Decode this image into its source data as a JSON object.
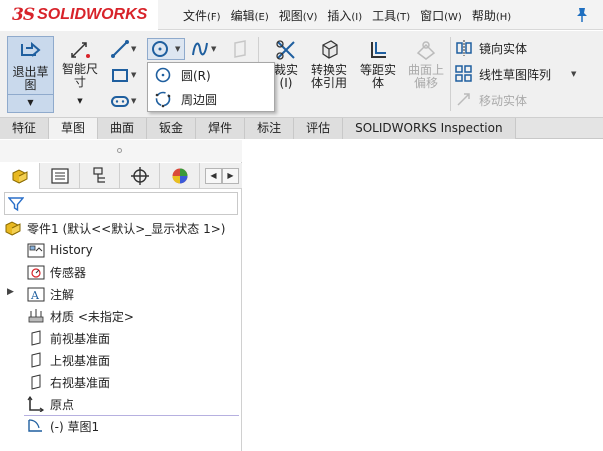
{
  "app": {
    "logo_prefix": "3S",
    "logo_text": "SOLIDWORKS"
  },
  "menu": [
    {
      "label": "文件",
      "accel": "(F)"
    },
    {
      "label": "编辑",
      "accel": "(E)"
    },
    {
      "label": "视图",
      "accel": "(V)"
    },
    {
      "label": "插入",
      "accel": "(I)"
    },
    {
      "label": "工具",
      "accel": "(T)"
    },
    {
      "label": "窗口",
      "accel": "(W)"
    },
    {
      "label": "帮助",
      "accel": "(H)"
    }
  ],
  "ribbon": {
    "exit_sketch": "退出草图",
    "smart_dimension": "智能尺寸",
    "trim_partial": "裁实",
    "trim_partial_2": "(I)",
    "convert_entities": "转换实体引用",
    "offset_entities": "等距实体",
    "offset_surface": "曲面上偏移",
    "mirror_entities": "镜向实体",
    "linear_pattern": "线性草图阵列",
    "move_entities": "移动实体"
  },
  "popup": {
    "items": [
      {
        "label": "圆(R)"
      },
      {
        "label": "周边圆"
      }
    ]
  },
  "tabs": [
    {
      "label": "特征",
      "active": false
    },
    {
      "label": "草图",
      "active": true
    },
    {
      "label": "曲面",
      "active": false
    },
    {
      "label": "钣金",
      "active": false
    },
    {
      "label": "焊件",
      "active": false
    },
    {
      "label": "标注",
      "active": false
    },
    {
      "label": "评估",
      "active": false
    },
    {
      "label": "SOLIDWORKS Inspection",
      "active": false
    }
  ],
  "tree": {
    "part": "零件1 (默认<<默认>_显示状态 1>)",
    "items": [
      {
        "label": "History"
      },
      {
        "label": "传感器"
      },
      {
        "label": "注解"
      },
      {
        "label": "材质 <未指定>"
      },
      {
        "label": "前视基准面"
      },
      {
        "label": "上视基准面"
      },
      {
        "label": "右视基准面"
      },
      {
        "label": "原点"
      },
      {
        "label": "(-) 草图1"
      }
    ]
  },
  "colors": {
    "brand": "#d8232a",
    "active_button_bg": "#c9d9ec",
    "icon_blue": "#1f5f9f",
    "folder_yellow": "#e8b820"
  }
}
